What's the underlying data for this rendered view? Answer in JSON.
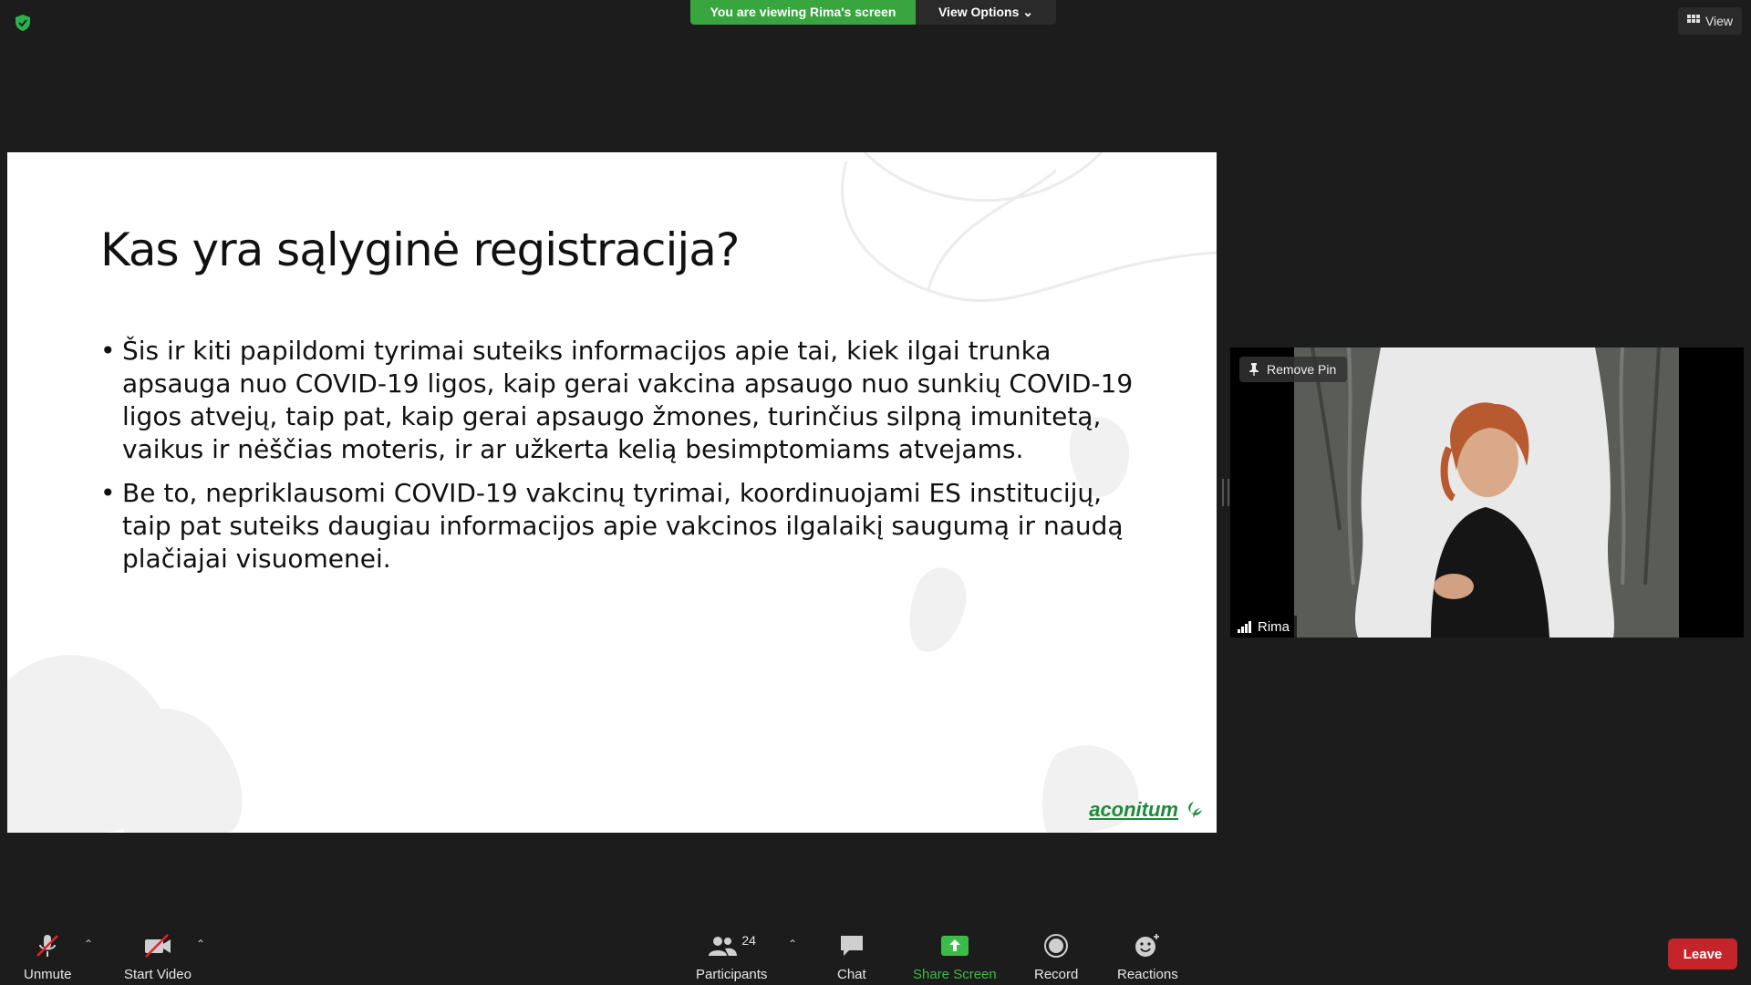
{
  "banner": {
    "viewing_text": "You are viewing Rima's screen",
    "view_options_label": "View Options"
  },
  "top_right": {
    "view_label": "View"
  },
  "slide": {
    "title": "Kas yra sąlyginė registracija?",
    "bullets": [
      "Šis ir kiti papildomi tyrimai suteiks informacijos apie tai, kiek ilgai trunka apsauga nuo COVID-19 ligos, kaip gerai vakcina apsaugo nuo sunkių COVID-19 ligos atvejų, taip pat, kaip gerai apsaugo žmones, turinčius silpną imunitetą, vaikus ir nėščias moteris, ir ar užkerta kelią besimptomiams atvejams.",
      "Be to, nepriklausomi COVID-19 vakcinų tyrimai, koordinuojami ES institucijų, taip pat suteiks daugiau informacijos apie vakcinos ilgalaikį saugumą ir naudą plačiajai visuomenei."
    ],
    "logo_text": "aconitum"
  },
  "video": {
    "remove_pin_label": "Remove Pin",
    "participant_name": "Rima"
  },
  "toolbar": {
    "unmute_label": "Unmute",
    "start_video_label": "Start Video",
    "participants_label": "Participants",
    "participants_count": "24",
    "chat_label": "Chat",
    "share_screen_label": "Share Screen",
    "record_label": "Record",
    "reactions_label": "Reactions",
    "leave_label": "Leave"
  },
  "colors": {
    "share_green": "#39a53f",
    "leave_red": "#c4252a",
    "brand_green": "#1e8a3b"
  }
}
